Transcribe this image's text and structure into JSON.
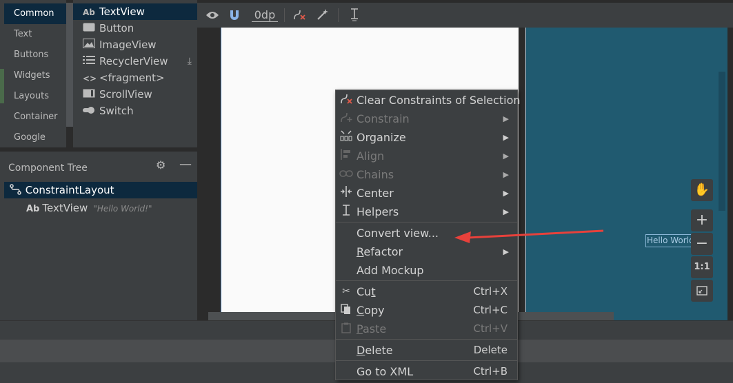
{
  "palette": {
    "categories": [
      "Common",
      "Text",
      "Buttons",
      "Widgets",
      "Layouts",
      "Container",
      "Google"
    ],
    "selected_category": "Common",
    "widgets": [
      {
        "icon": "Ab",
        "label": "TextView"
      },
      {
        "icon": "button-icon",
        "label": "Button"
      },
      {
        "icon": "image-icon",
        "label": "ImageView"
      },
      {
        "icon": "list-icon",
        "label": "RecyclerView"
      },
      {
        "icon": "fragment-icon",
        "label": "<fragment>"
      },
      {
        "icon": "scroll-icon",
        "label": "ScrollView"
      },
      {
        "icon": "switch-icon",
        "label": "Switch"
      }
    ]
  },
  "component_tree": {
    "title": "Component Tree",
    "nodes": [
      {
        "label": "ConstraintLayout"
      },
      {
        "icon": "Ab",
        "label": "TextView",
        "note": "\"Hello World!\""
      }
    ]
  },
  "toolbar": {
    "margin_value": "0dp"
  },
  "design": {
    "blueprint_text": "Hello World",
    "zoom_fit_label": "1:1"
  },
  "context_menu": {
    "items": [
      {
        "label": "Clear Constraints of Selection",
        "icon": "clear-constraints-icon",
        "enabled": true
      },
      {
        "label": "Constrain",
        "icon": "constrain-icon",
        "enabled": false,
        "submenu": true
      },
      {
        "label": "Organize",
        "icon": "organize-icon",
        "enabled": true,
        "submenu": true
      },
      {
        "label": "Align",
        "icon": "align-icon",
        "enabled": false,
        "submenu": true
      },
      {
        "label": "Chains",
        "icon": "chains-icon",
        "enabled": false,
        "submenu": true
      },
      {
        "label": "Center",
        "icon": "center-icon",
        "enabled": true,
        "submenu": true
      },
      {
        "label": "Helpers",
        "icon": "helpers-icon",
        "enabled": true,
        "submenu": true
      },
      {
        "label": "Convert view...",
        "enabled": true
      },
      {
        "label": "Refactor",
        "enabled": true,
        "submenu": true
      },
      {
        "label": "Add Mockup",
        "enabled": true
      },
      {
        "label": "Cut",
        "icon": "cut-icon",
        "shortcut": "Ctrl+X",
        "enabled": true
      },
      {
        "label": "Copy",
        "icon": "copy-icon",
        "shortcut": "Ctrl+C",
        "enabled": true
      },
      {
        "label": "Paste",
        "icon": "paste-icon",
        "shortcut": "Ctrl+V",
        "enabled": false
      },
      {
        "label": "Delete",
        "shortcut": "Delete",
        "enabled": true
      },
      {
        "label": "Go to XML",
        "shortcut": "Ctrl+B",
        "enabled": true
      }
    ]
  },
  "colors": {
    "selection": "#0d293e",
    "blueprint": "#205a70",
    "annotation_arrow": "#e8413b"
  }
}
